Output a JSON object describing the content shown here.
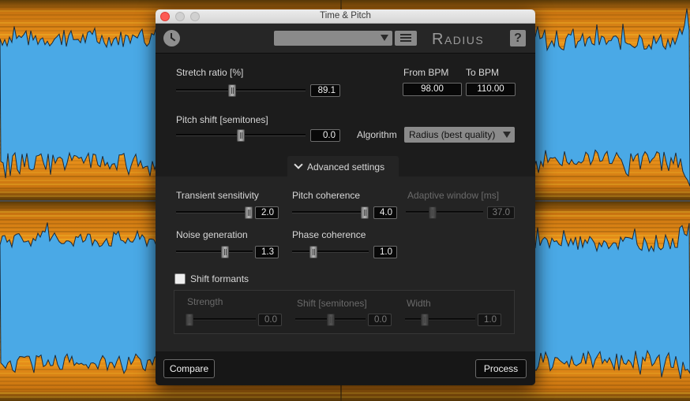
{
  "window": {
    "title": "Time & Pitch"
  },
  "toolbar": {
    "brand": "Radius",
    "help_label": "?"
  },
  "stretch": {
    "label": "Stretch ratio [%]",
    "value": "89.1",
    "level_pct": 43
  },
  "bpm": {
    "from_label": "From BPM",
    "from_value": "98.00",
    "to_label": "To BPM",
    "to_value": "110.00"
  },
  "pitch": {
    "label": "Pitch shift [semitones]",
    "value": "0.0",
    "level_pct": 50
  },
  "algorithm": {
    "label": "Algorithm",
    "selected": "Radius (best quality)"
  },
  "advanced": {
    "toggle_label": "Advanced settings",
    "transient": {
      "label": "Transient sensitivity",
      "value": "2.0",
      "level_pct": 100
    },
    "pitch_coherence": {
      "label": "Pitch coherence",
      "value": "4.0",
      "level_pct": 100
    },
    "adaptive_window": {
      "label": "Adaptive window [ms]",
      "value": "37.0",
      "level_pct": 33
    },
    "noise": {
      "label": "Noise generation",
      "value": "1.3",
      "level_pct": 65
    },
    "phase_coherence": {
      "label": "Phase coherence",
      "value": "1.0",
      "level_pct": 25
    }
  },
  "formants": {
    "checkbox_label": "Shift formants",
    "checked": false,
    "strength": {
      "label": "Strength",
      "value": "0.0",
      "level_pct": 0
    },
    "shift": {
      "label": "Shift [semitones]",
      "value": "0.0",
      "level_pct": 50
    },
    "width": {
      "label": "Width",
      "value": "1.0",
      "level_pct": 25
    }
  },
  "footer": {
    "compare_label": "Compare",
    "process_label": "Process"
  },
  "colors": {
    "wave_blue": "#4aa9e6",
    "spectrum_orange": "#e28b16",
    "spectrum_yellow": "#f2c531",
    "close_red": "#fd5b55"
  }
}
